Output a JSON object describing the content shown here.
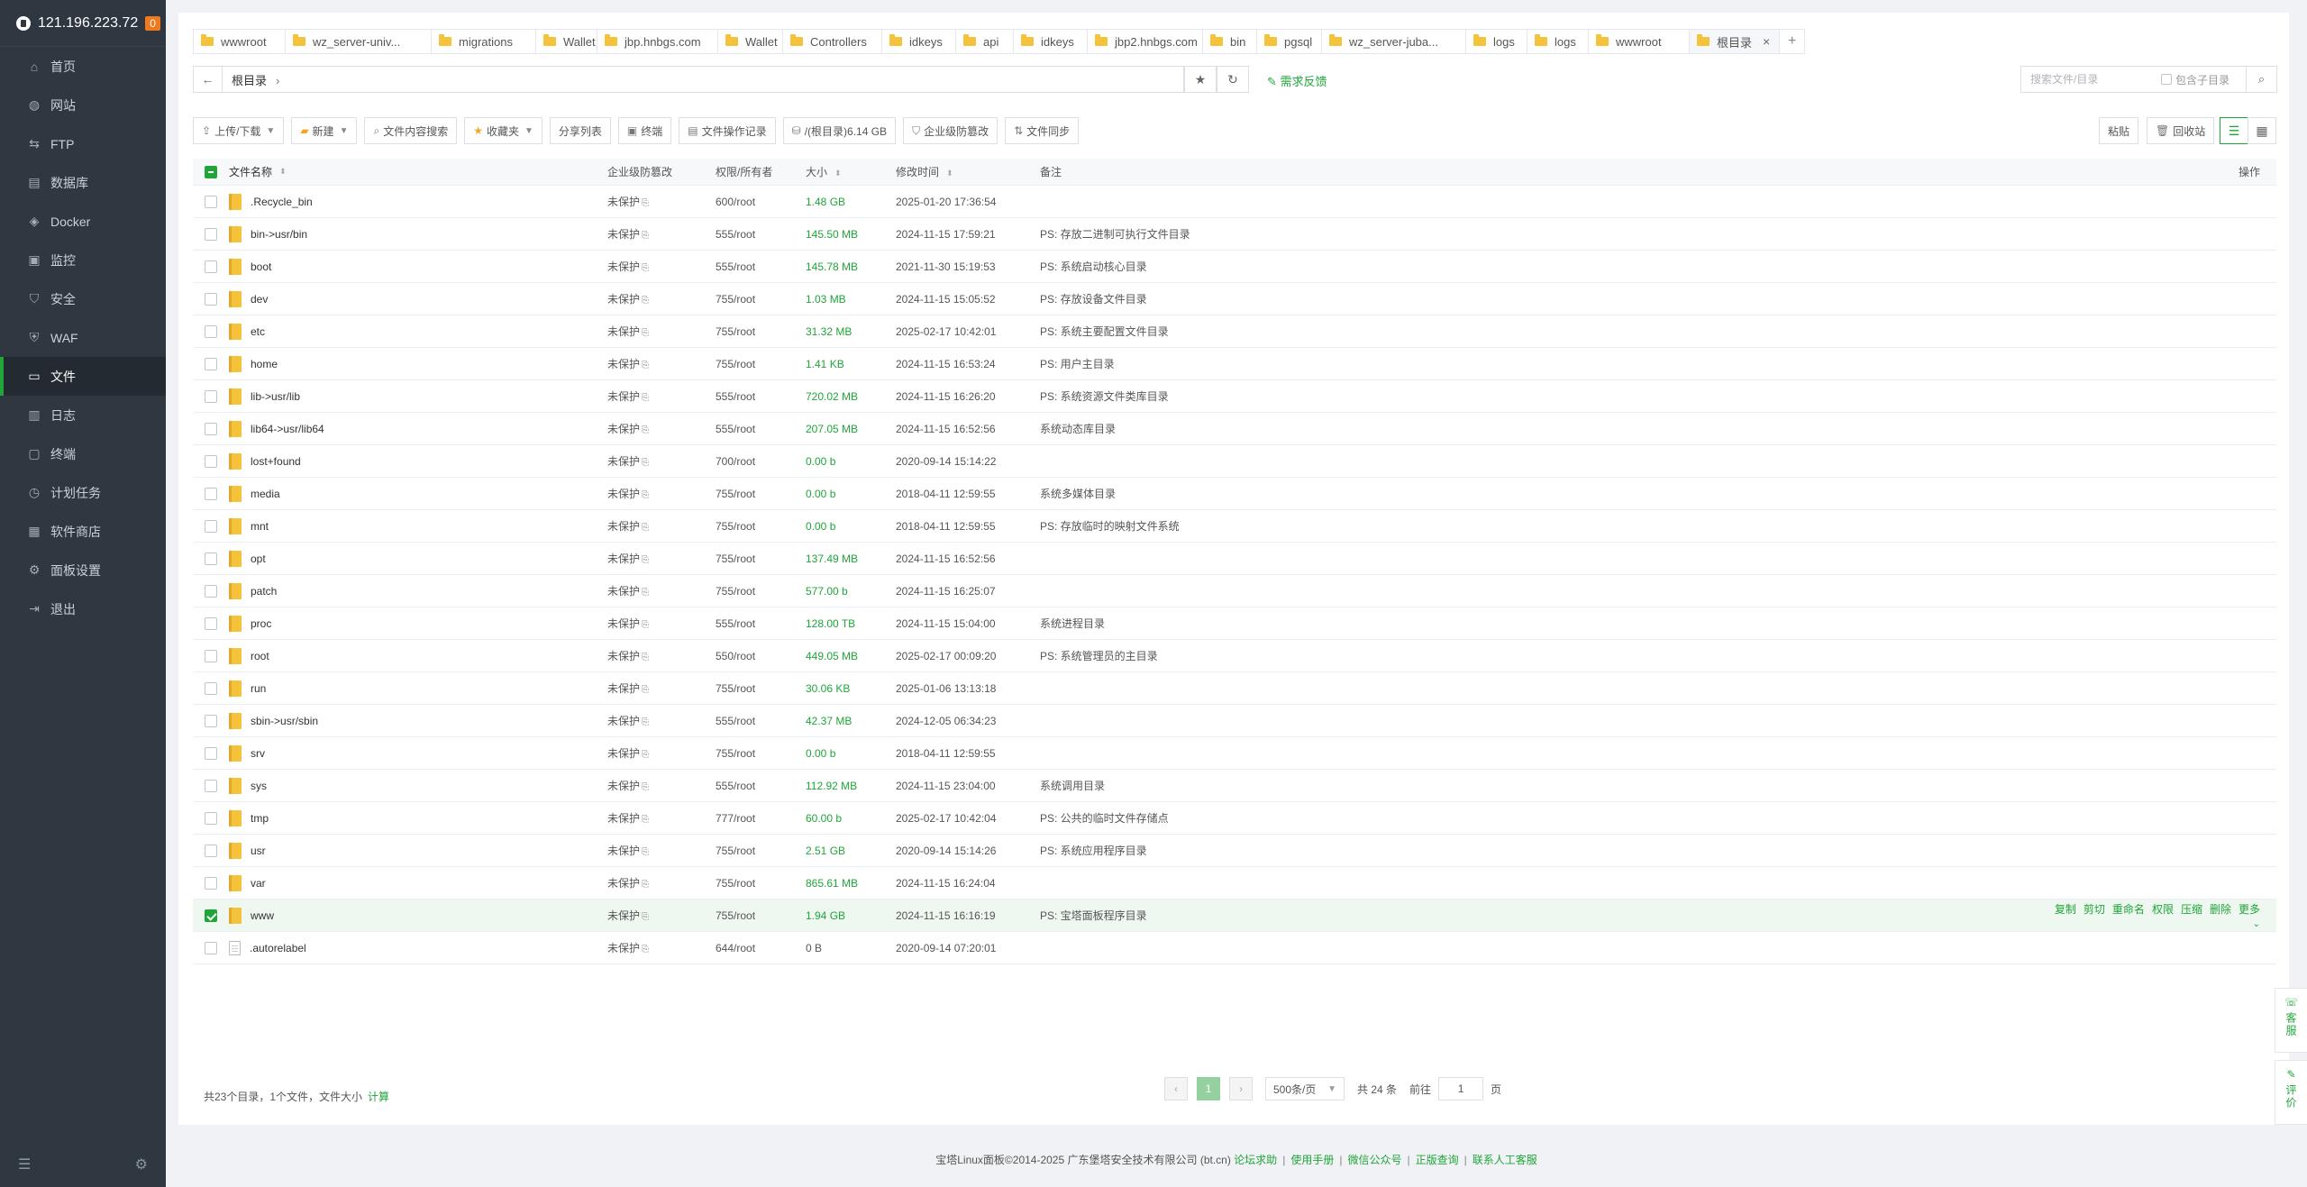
{
  "server": {
    "ip": "121.196.223.72",
    "badge": "0"
  },
  "sidebar": {
    "items": [
      {
        "label": "首页",
        "icon": "⌂"
      },
      {
        "label": "网站",
        "icon": "◍"
      },
      {
        "label": "FTP",
        "icon": "⇆"
      },
      {
        "label": "数据库",
        "icon": "▤"
      },
      {
        "label": "Docker",
        "icon": "◈"
      },
      {
        "label": "监控",
        "icon": "▣"
      },
      {
        "label": "安全",
        "icon": "⛉"
      },
      {
        "label": "WAF",
        "icon": "⛨"
      },
      {
        "label": "文件",
        "icon": "▭"
      },
      {
        "label": "日志",
        "icon": "▥"
      },
      {
        "label": "终端",
        "icon": "▢"
      },
      {
        "label": "计划任务",
        "icon": "◷"
      },
      {
        "label": "软件商店",
        "icon": "▦"
      },
      {
        "label": "面板设置",
        "icon": "⚙"
      },
      {
        "label": "退出",
        "icon": "⇥"
      }
    ],
    "active_index": 8
  },
  "tabs": [
    {
      "label": "wwwroot"
    },
    {
      "label": "wz_server-univ..."
    },
    {
      "label": "migrations"
    },
    {
      "label": "Wallet"
    },
    {
      "label": "jbp.hnbgs.com"
    },
    {
      "label": "Wallet"
    },
    {
      "label": "Controllers"
    },
    {
      "label": "idkeys"
    },
    {
      "label": "api"
    },
    {
      "label": "idkeys"
    },
    {
      "label": "jbp2.hnbgs.com"
    },
    {
      "label": "bin"
    },
    {
      "label": "pgsql"
    },
    {
      "label": "wz_server-juba..."
    },
    {
      "label": "logs"
    },
    {
      "label": "logs"
    },
    {
      "label": "wwwroot"
    },
    {
      "label": "根目录"
    }
  ],
  "path": {
    "crumb": "根目录"
  },
  "feedback": "需求反馈",
  "search": {
    "placeholder": "搜索文件/目录",
    "include_sub": "包含子目录"
  },
  "toolbar": {
    "upload": "上传/下载",
    "new": "新建",
    "content_search": "文件内容搜索",
    "favorites": "收藏夹",
    "share_list": "分享列表",
    "terminal": "终端",
    "file_log": "文件操作记录",
    "disk": "/(根目录)6.14 GB",
    "tamper": "企业级防篡改",
    "sync": "文件同步",
    "paste": "粘贴",
    "recycle": "回收站"
  },
  "columns": {
    "name": "文件名称",
    "protect": "企业级防篡改",
    "perm": "权限/所有者",
    "size": "大小",
    "mtime": "修改时间",
    "note": "备注",
    "ops": "操作"
  },
  "rows": [
    {
      "name": ".Recycle_bin",
      "type": "dir",
      "protect": "未保护",
      "perm": "600/root",
      "size": "1.48 GB",
      "mtime": "2025-01-20 17:36:54",
      "note": ""
    },
    {
      "name": "bin->usr/bin",
      "type": "dir",
      "protect": "未保护",
      "perm": "555/root",
      "size": "145.50 MB",
      "mtime": "2024-11-15 17:59:21",
      "note": "PS: 存放二进制可执行文件目录"
    },
    {
      "name": "boot",
      "type": "dir",
      "protect": "未保护",
      "perm": "555/root",
      "size": "145.78 MB",
      "mtime": "2021-11-30 15:19:53",
      "note": "PS: 系统启动核心目录"
    },
    {
      "name": "dev",
      "type": "dir",
      "protect": "未保护",
      "perm": "755/root",
      "size": "1.03 MB",
      "mtime": "2024-11-15 15:05:52",
      "note": "PS: 存放设备文件目录"
    },
    {
      "name": "etc",
      "type": "dir",
      "protect": "未保护",
      "perm": "755/root",
      "size": "31.32 MB",
      "mtime": "2025-02-17 10:42:01",
      "note": "PS: 系统主要配置文件目录"
    },
    {
      "name": "home",
      "type": "dir",
      "protect": "未保护",
      "perm": "755/root",
      "size": "1.41 KB",
      "mtime": "2024-11-15 16:53:24",
      "note": "PS: 用户主目录"
    },
    {
      "name": "lib->usr/lib",
      "type": "dir",
      "protect": "未保护",
      "perm": "555/root",
      "size": "720.02 MB",
      "mtime": "2024-11-15 16:26:20",
      "note": "PS: 系统资源文件类库目录"
    },
    {
      "name": "lib64->usr/lib64",
      "type": "dir",
      "protect": "未保护",
      "perm": "555/root",
      "size": "207.05 MB",
      "mtime": "2024-11-15 16:52:56",
      "note": "系统动态库目录"
    },
    {
      "name": "lost+found",
      "type": "dir",
      "protect": "未保护",
      "perm": "700/root",
      "size": "0.00 b",
      "mtime": "2020-09-14 15:14:22",
      "note": ""
    },
    {
      "name": "media",
      "type": "dir",
      "protect": "未保护",
      "perm": "755/root",
      "size": "0.00 b",
      "mtime": "2018-04-11 12:59:55",
      "note": "系统多媒体目录"
    },
    {
      "name": "mnt",
      "type": "dir",
      "protect": "未保护",
      "perm": "755/root",
      "size": "0.00 b",
      "mtime": "2018-04-11 12:59:55",
      "note": "PS: 存放临时的映射文件系统"
    },
    {
      "name": "opt",
      "type": "dir",
      "protect": "未保护",
      "perm": "755/root",
      "size": "137.49 MB",
      "mtime": "2024-11-15 16:52:56",
      "note": ""
    },
    {
      "name": "patch",
      "type": "dir",
      "protect": "未保护",
      "perm": "755/root",
      "size": "577.00 b",
      "mtime": "2024-11-15 16:25:07",
      "note": ""
    },
    {
      "name": "proc",
      "type": "dir",
      "protect": "未保护",
      "perm": "555/root",
      "size": "128.00 TB",
      "mtime": "2024-11-15 15:04:00",
      "note": "系统进程目录"
    },
    {
      "name": "root",
      "type": "dir",
      "protect": "未保护",
      "perm": "550/root",
      "size": "449.05 MB",
      "mtime": "2025-02-17 00:09:20",
      "note": "PS: 系统管理员的主目录"
    },
    {
      "name": "run",
      "type": "dir",
      "protect": "未保护",
      "perm": "755/root",
      "size": "30.06 KB",
      "mtime": "2025-01-06 13:13:18",
      "note": ""
    },
    {
      "name": "sbin->usr/sbin",
      "type": "dir",
      "protect": "未保护",
      "perm": "555/root",
      "size": "42.37 MB",
      "mtime": "2024-12-05 06:34:23",
      "note": ""
    },
    {
      "name": "srv",
      "type": "dir",
      "protect": "未保护",
      "perm": "755/root",
      "size": "0.00 b",
      "mtime": "2018-04-11 12:59:55",
      "note": ""
    },
    {
      "name": "sys",
      "type": "dir",
      "protect": "未保护",
      "perm": "555/root",
      "size": "112.92 MB",
      "mtime": "2024-11-15 23:04:00",
      "note": "系统调用目录"
    },
    {
      "name": "tmp",
      "type": "dir",
      "protect": "未保护",
      "perm": "777/root",
      "size": "60.00 b",
      "mtime": "2025-02-17 10:42:04",
      "note": "PS: 公共的临时文件存储点"
    },
    {
      "name": "usr",
      "type": "dir",
      "protect": "未保护",
      "perm": "755/root",
      "size": "2.51 GB",
      "mtime": "2020-09-14 15:14:26",
      "note": "PS: 系统应用程序目录"
    },
    {
      "name": "var",
      "type": "dir",
      "protect": "未保护",
      "perm": "755/root",
      "size": "865.61 MB",
      "mtime": "2024-11-15 16:24:04",
      "note": ""
    },
    {
      "name": "www",
      "type": "dir",
      "protect": "未保护",
      "perm": "755/root",
      "size": "1.94 GB",
      "mtime": "2024-11-15 16:16:19",
      "note": "PS: 宝塔面板程序目录"
    },
    {
      "name": ".autorelabel",
      "type": "file",
      "protect": "未保护",
      "perm": "644/root",
      "size": "0 B",
      "mtime": "2020-09-14 07:20:01",
      "note": ""
    }
  ],
  "selected_row": 22,
  "row_ops": [
    "复制",
    "剪切",
    "重命名",
    "权限",
    "压缩",
    "删除",
    "更多"
  ],
  "summary": {
    "text": "共23个目录，1个文件，文件大小",
    "calc": "计算"
  },
  "pager": {
    "current": "1",
    "per_page": "500条/页",
    "total": "共 24 条",
    "goto_label": "前往",
    "goto_value": "1",
    "page_suffix": "页"
  },
  "float": {
    "service": "客服",
    "review": "评价"
  },
  "footer": {
    "copyright": "宝塔Linux面板©2014-2025 广东堡塔安全技术有限公司 (bt.cn)",
    "links": [
      "论坛求助",
      "使用手册",
      "微信公众号",
      "正版查询",
      "联系人工客服"
    ]
  },
  "colors": {
    "accent": "#20a53a",
    "sidebar_bg": "#2f3740",
    "folder": "#f5c33b"
  }
}
